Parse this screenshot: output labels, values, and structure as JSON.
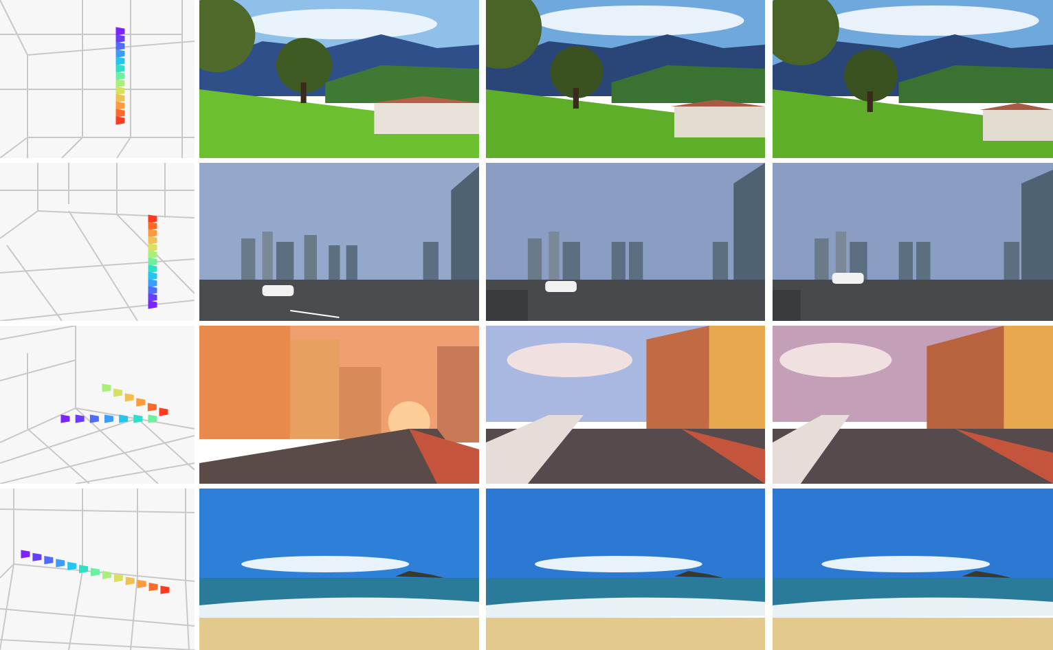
{
  "rows": [
    {
      "scene": "alpine-village",
      "trajectory": "vertical-up",
      "colors": {
        "sky": "#7fb2e0",
        "mountain": "#2f4f8a",
        "grass": "#6cbf2f",
        "tree": "#3f5a22",
        "roof": "#b46048"
      }
    },
    {
      "scene": "city-road",
      "trajectory": "vertical-down",
      "colors": {
        "sky": "#8aa0c8",
        "tower": "#5b6f80",
        "road": "#4a4c50",
        "car": "#f2f2f2"
      }
    },
    {
      "scene": "anime-street",
      "trajectory": "turn-right",
      "colors": {
        "sky": "#f0a070",
        "building": "#e88a4c",
        "road": "#5a4a48",
        "sidewalk": "#c4543c"
      }
    },
    {
      "scene": "beach",
      "trajectory": "diagonal-right",
      "colors": {
        "sky": "#2e7fd8",
        "sea": "#2a7a9a",
        "foam": "#e8f2f4",
        "sand": "#e3c98c"
      }
    }
  ],
  "camera_colors": [
    "#7e22ff",
    "#6a3cff",
    "#4f6cff",
    "#3a9cff",
    "#22c6f0",
    "#2ee0c8",
    "#6cf0a0",
    "#a8f07a",
    "#d8e060",
    "#f0c050",
    "#ff9a3c",
    "#ff6a2a",
    "#ff3a20"
  ]
}
